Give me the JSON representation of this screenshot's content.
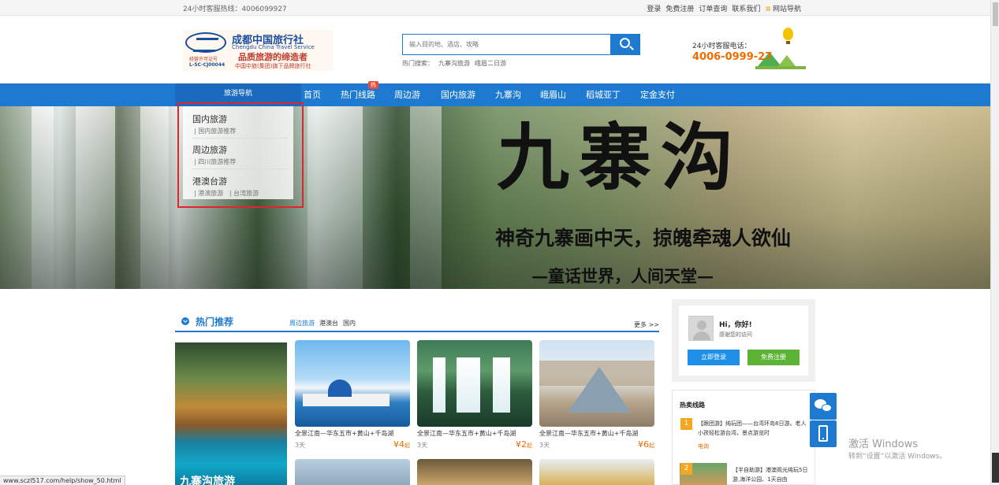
{
  "topbar": {
    "hotline": "24小时客服热线：4006099927",
    "links": [
      "登录",
      "免费注册",
      "订单查询",
      "联系我们"
    ],
    "site_nav": "网站导航",
    "site_nav_icon": "menu-bars-icon"
  },
  "logo": {
    "cn": "成都中国旅行社",
    "en": "Chengdu China Travel Service",
    "slogan": "品质旅游的缔造者",
    "license_label": "经营许可证号",
    "license_no": "L-SC-CJ00044",
    "brand_line": "中国中旅(集团)旗下品牌旅行社"
  },
  "search": {
    "placeholder": "输入目的地、酒店、攻略",
    "hot_label": "热门搜索：",
    "hot_keywords": [
      "九寨沟旅游",
      "峨眉二日游"
    ],
    "button_icon": "search-icon"
  },
  "phone": {
    "label": "24小时客服电话：",
    "number": "4006-0999-27"
  },
  "nav": {
    "guide_label": "旅游导航",
    "items": [
      "首页",
      "热门线路",
      "周边游",
      "国内旅游",
      "九寨沟",
      "峨眉山",
      "稻城亚丁",
      "定金支付"
    ],
    "hot_badge": "热"
  },
  "banner": {
    "title": "九寨沟",
    "line1": "神奇九寨画中天，掠魄牵魂人欲仙",
    "line2": "—童话世界，人间天堂—"
  },
  "dropdown": {
    "groups": [
      {
        "title": "国内旅游",
        "subs": [
          "国内旅游推荐"
        ]
      },
      {
        "title": "周边旅游",
        "subs": [
          "四川旅游推荐"
        ]
      },
      {
        "title": "港澳台游",
        "subs": [
          "港澳旅游",
          "台湾旅游"
        ]
      }
    ]
  },
  "recommend": {
    "title": "热门推荐",
    "tabs": [
      "周边旅游",
      "港澳台",
      "国内"
    ],
    "active_tab": 0,
    "more": "更多 >>",
    "feature_title": "九寨沟旅游",
    "cards": [
      {
        "name": "全景江南—华东五市+黄山+千岛湖",
        "days": "3天",
        "price": "¥4",
        "unit": "起",
        "image": "santorini"
      },
      {
        "name": "全景江南—华东五市+黄山+千岛湖",
        "days": "3天",
        "price": "¥2",
        "unit": "起",
        "image": "waterfall"
      },
      {
        "name": "全景江南—华东五市+黄山+千岛湖",
        "days": "3天",
        "price": "¥6",
        "unit": "起",
        "image": "louvre"
      }
    ]
  },
  "login": {
    "greeting": "Hi，你好!",
    "thanks": "感谢您的访问",
    "login_btn": "立即登录",
    "register_btn": "免费注册"
  },
  "hot_routes": {
    "title": "热卖线路",
    "items": [
      {
        "rank": "1",
        "text": "【跟团游】纯玩团——台湾环岛8日游。老人小孩轻松游台湾，景点游览时",
        "tag": "电询"
      },
      {
        "rank": "2",
        "text": "【半自助游】港澳观光纯玩5日游,海洋公园、1天自由"
      }
    ]
  },
  "float": {
    "wechat_icon": "wechat-icon",
    "mobile_icon": "mobile-phone-icon"
  },
  "windows": {
    "line1": "激活 Windows",
    "line2": "转到“设置”以激活 Windows。"
  },
  "status_url": "www.sczl517.com/help/show_50.html",
  "colors": {
    "brand_blue": "#1e7ad0",
    "accent_orange": "#f06c00",
    "price_orange": "#e86b00",
    "register_green": "#5cb335",
    "highlight_red": "#e0262a"
  }
}
